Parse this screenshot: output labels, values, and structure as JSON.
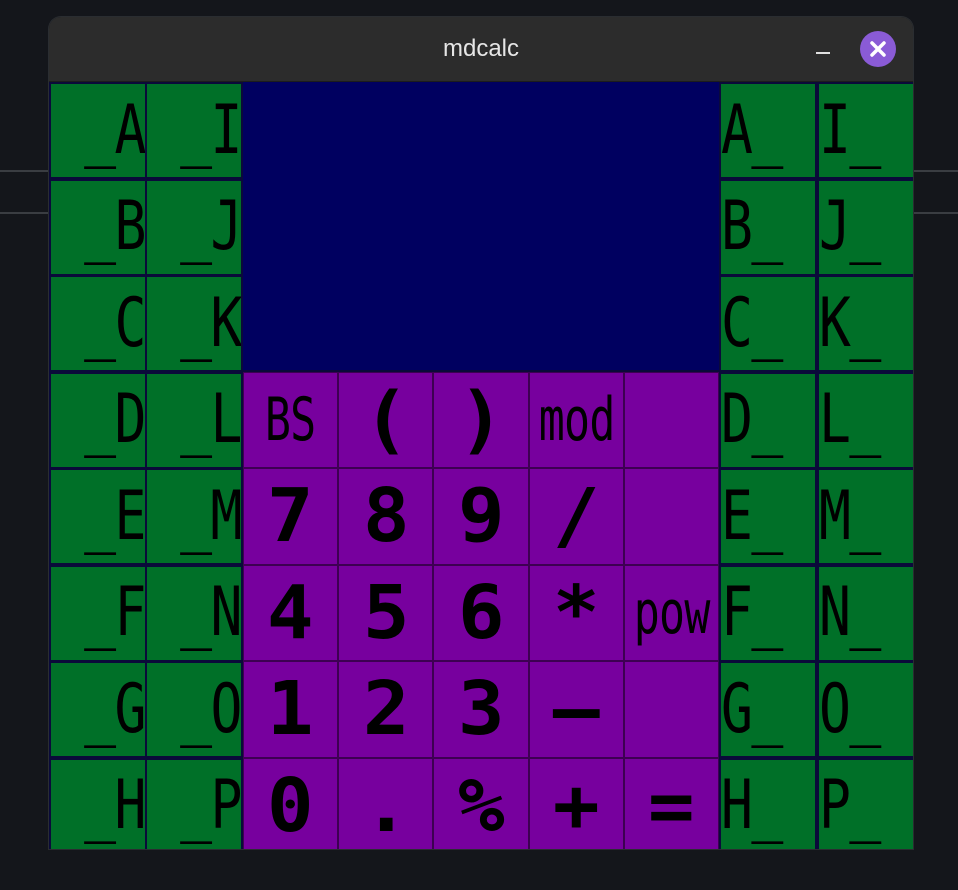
{
  "window": {
    "title": "mdcalc"
  },
  "display": {
    "value": ""
  },
  "left_keys": [
    [
      "_A",
      "_I"
    ],
    [
      "_B",
      "_J"
    ],
    [
      "_C",
      "_K"
    ],
    [
      "_D",
      "_L"
    ],
    [
      "_E",
      "_M"
    ],
    [
      "_F",
      "_N"
    ],
    [
      "_G",
      "_O"
    ],
    [
      "_H",
      "_P"
    ]
  ],
  "right_keys": [
    [
      "A_",
      "I_"
    ],
    [
      "B_",
      "J_"
    ],
    [
      "C_",
      "K_"
    ],
    [
      "D_",
      "L_"
    ],
    [
      "E_",
      "M_"
    ],
    [
      "F_",
      "N_"
    ],
    [
      "G_",
      "O_"
    ],
    [
      "H_",
      "P_"
    ]
  ],
  "keypad": [
    [
      {
        "label": "BS",
        "name": "backspace"
      },
      {
        "label": "(",
        "name": "open-paren"
      },
      {
        "label": ")",
        "name": "close-paren"
      },
      {
        "label": "mod",
        "name": "mod"
      },
      {
        "label": "",
        "name": "blank-1"
      }
    ],
    [
      {
        "label": "7",
        "name": "digit-7"
      },
      {
        "label": "8",
        "name": "digit-8"
      },
      {
        "label": "9",
        "name": "digit-9"
      },
      {
        "label": "/",
        "name": "divide"
      },
      {
        "label": "",
        "name": "blank-2"
      }
    ],
    [
      {
        "label": "4",
        "name": "digit-4"
      },
      {
        "label": "5",
        "name": "digit-5"
      },
      {
        "label": "6",
        "name": "digit-6"
      },
      {
        "label": "*",
        "name": "multiply"
      },
      {
        "label": "pow",
        "name": "pow"
      }
    ],
    [
      {
        "label": "1",
        "name": "digit-1"
      },
      {
        "label": "2",
        "name": "digit-2"
      },
      {
        "label": "3",
        "name": "digit-3"
      },
      {
        "label": "—",
        "name": "subtract"
      },
      {
        "label": "",
        "name": "blank-3"
      }
    ],
    [
      {
        "label": "0",
        "name": "digit-0"
      },
      {
        "label": ".",
        "name": "decimal-point"
      },
      {
        "label": "%",
        "name": "percent"
      },
      {
        "label": "+",
        "name": "add"
      },
      {
        "label": "=",
        "name": "equals"
      }
    ]
  ],
  "colors": {
    "key_green": "#007028",
    "key_purple": "#77009e",
    "display_bg": "#000060",
    "close_button": "#8a5bd6"
  },
  "icons": {
    "minimize": "minimize-icon",
    "close": "close-x-icon"
  }
}
